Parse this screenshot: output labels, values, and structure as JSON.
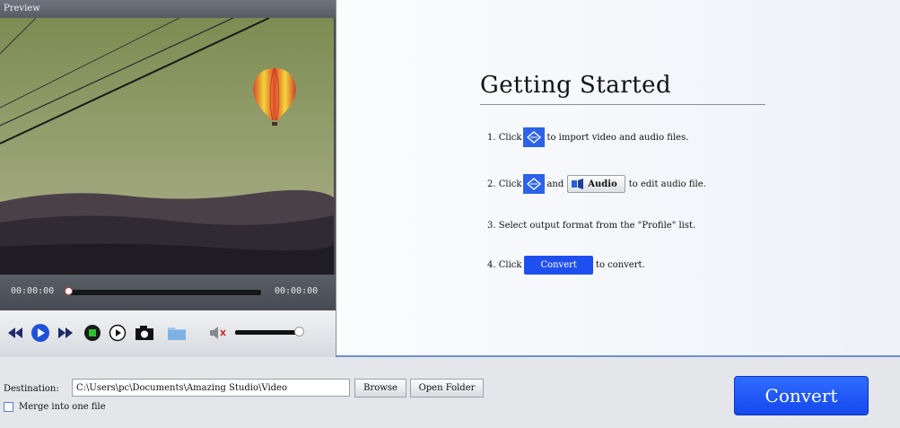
{
  "preview": {
    "title": "Preview",
    "time_current": "00:00:00",
    "time_total": "00:00:00",
    "progress": 0,
    "volume": 1.0,
    "controls": [
      "rewind-icon",
      "play-icon",
      "fast-forward-icon",
      "stop-icon",
      "next-frame-icon",
      "snapshot-icon",
      "folder-icon"
    ]
  },
  "guide": {
    "title": "Getting Started",
    "step1": {
      "num": "1. Click",
      "text": "to import video and audio files."
    },
    "step2": {
      "num": "2. Click",
      "and": "and",
      "audio_label": "Audio",
      "text": "to edit audio file."
    },
    "step3": {
      "text": "3. Select output format from the \"Profile\" list."
    },
    "step4": {
      "num": "4. Click",
      "button": "Convert",
      "text": "to convert."
    }
  },
  "bottom": {
    "destination_label": "Destination:",
    "destination_value": "C:\\Users\\pc\\Documents\\Amazing Studio\\Video",
    "browse": "Browse",
    "open_folder": "Open Folder",
    "merge_label": "Merge into one file",
    "convert": "Convert"
  },
  "colors": {
    "accent": "#1f4fef",
    "guide_border": "#6c8fd6"
  }
}
